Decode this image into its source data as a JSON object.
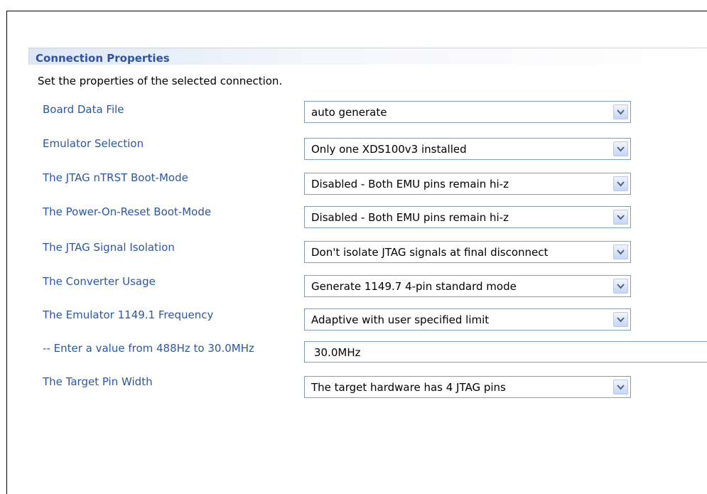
{
  "section": {
    "title": "Connection Properties",
    "description": "Set the properties of the selected connection."
  },
  "properties": [
    {
      "label": "Board Data File",
      "value": "auto generate",
      "type": "combo"
    },
    {
      "label": "Emulator Selection",
      "value": "Only one XDS100v3 installed",
      "type": "combo"
    },
    {
      "label": "The JTAG nTRST Boot-Mode",
      "value": "Disabled - Both EMU pins remain hi-z",
      "type": "combo"
    },
    {
      "label": "The Power-On-Reset Boot-Mode",
      "value": "Disabled - Both EMU pins remain hi-z",
      "type": "combo"
    },
    {
      "label": "The JTAG Signal Isolation",
      "value": "Don't isolate JTAG signals at final disconnect",
      "type": "combo"
    },
    {
      "label": "The Converter Usage",
      "value": "Generate 1149.7 4-pin standard mode",
      "type": "combo"
    },
    {
      "label": "The Emulator 1149.1 Frequency",
      "value": "Adaptive with user specified limit",
      "type": "combo"
    },
    {
      "label": "-- Enter a value from 488Hz to 30.0MHz",
      "value": "30.0MHz",
      "type": "text"
    },
    {
      "label": "The Target Pin Width",
      "value": "The target hardware has 4 JTAG pins",
      "type": "combo"
    }
  ],
  "icons": {
    "dropdown": "chevron-down-icon"
  },
  "colors": {
    "label": "#2c57a0",
    "title": "#2f53a2",
    "border": "#7f9db9"
  }
}
